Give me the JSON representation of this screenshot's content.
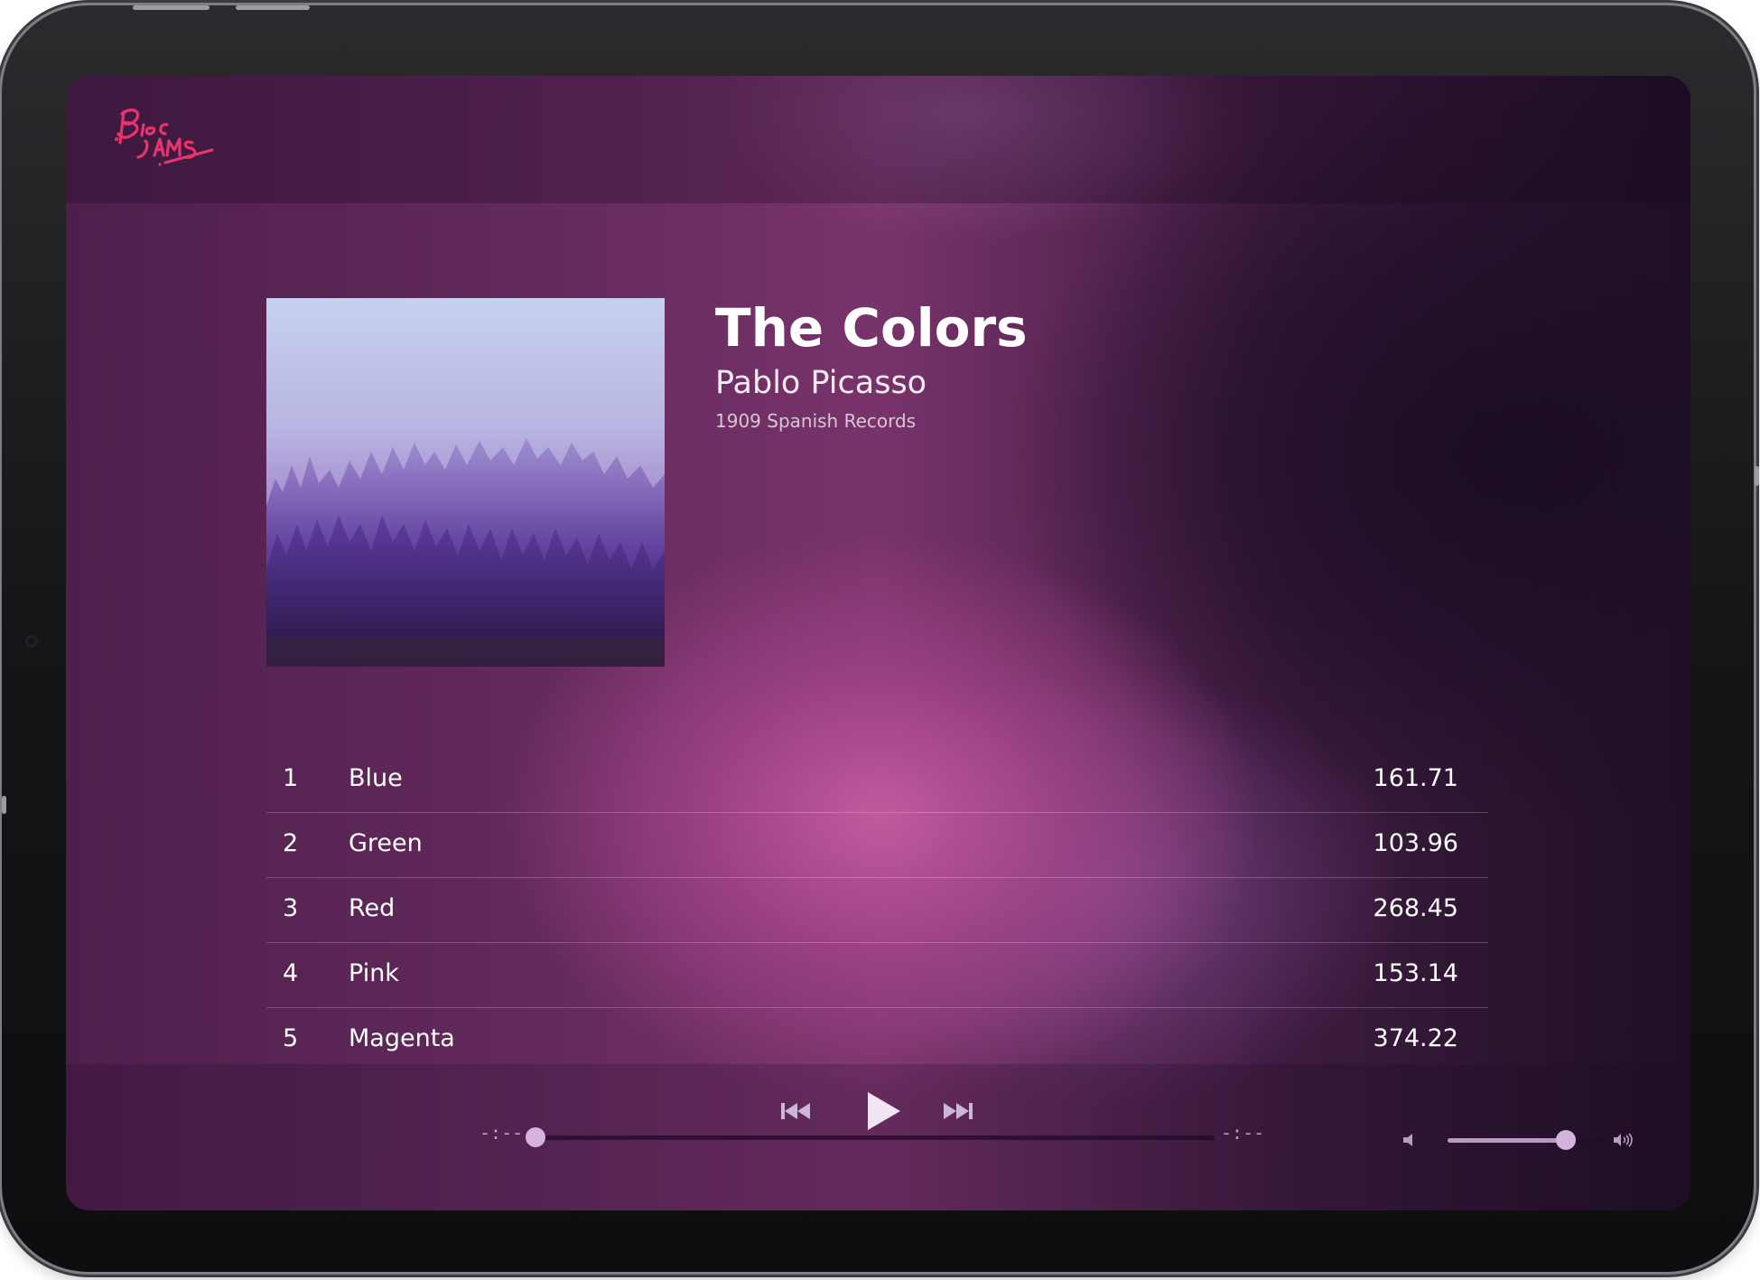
{
  "app": {
    "logo_text": "Bloc Jams",
    "logo_color": "#e8336f"
  },
  "album": {
    "title": "The Colors",
    "artist": "Pablo Picasso",
    "release_info": "1909 Spanish Records",
    "cover_description_icon": "album-cover-image"
  },
  "songs": [
    {
      "number": "1",
      "title": "Blue",
      "duration": "161.71"
    },
    {
      "number": "2",
      "title": "Green",
      "duration": "103.96"
    },
    {
      "number": "3",
      "title": "Red",
      "duration": "268.45"
    },
    {
      "number": "4",
      "title": "Pink",
      "duration": "153.14"
    },
    {
      "number": "5",
      "title": "Magenta",
      "duration": "374.22"
    }
  ],
  "player": {
    "prev_icon": "skip-previous-icon",
    "play_icon": "play-icon",
    "next_icon": "skip-next-icon",
    "current_time": "-:--",
    "total_time": "-:--",
    "seek_progress": 0.0,
    "volume_low_icon": "volume-low-icon",
    "volume_high_icon": "volume-high-icon",
    "volume_level": 0.76
  },
  "colors": {
    "accent": "#e8336f",
    "text": "#ffffff",
    "thumb": "#d6b3dc"
  }
}
